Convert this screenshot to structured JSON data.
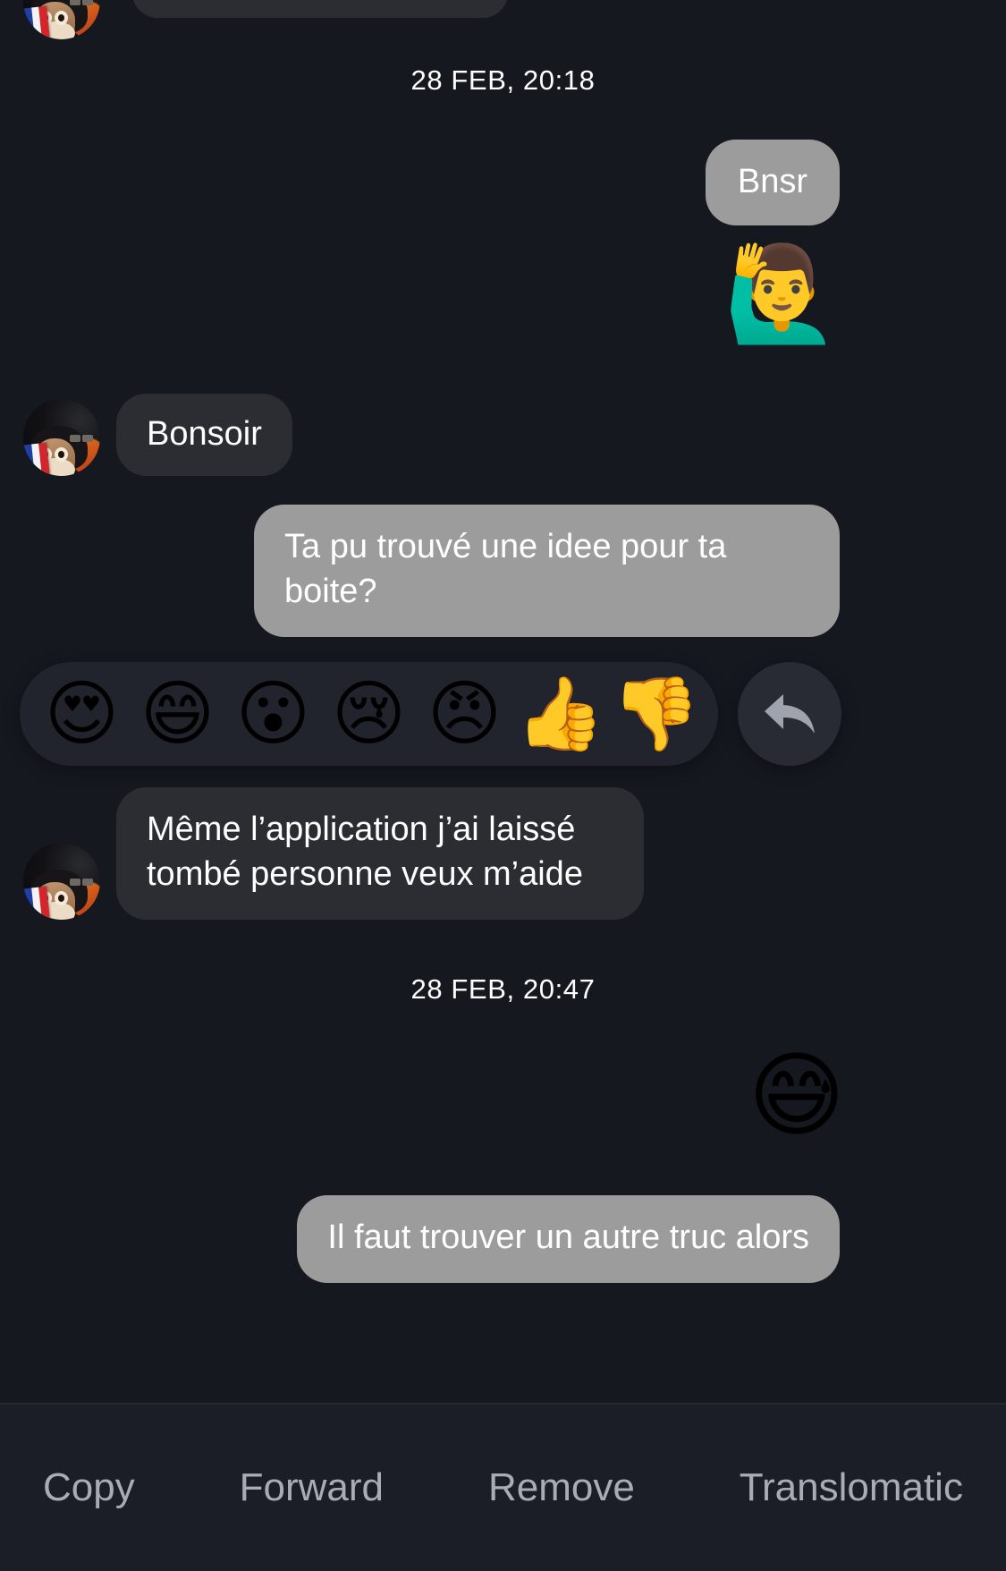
{
  "theme": {
    "background": "#15181f",
    "incoming_bubble": "#2c2d33",
    "selected_bubble": "#9c9c9c",
    "reaction_bar": "#21242c",
    "action_bar": "#1b1e26",
    "action_text": "#a9acb4",
    "text": "#ffffff"
  },
  "conversation": {
    "date_separator_1": "28 FEB, 20:18",
    "date_separator_2": "28 FEB, 20:47",
    "messages": [
      {
        "id": "m0",
        "side": "incoming",
        "type": "text",
        "text": "",
        "partial": true,
        "avatar": "dog-french-flag-avatar"
      },
      {
        "id": "m1",
        "side": "outgoing",
        "type": "text",
        "text": "Bnsr",
        "selected": true
      },
      {
        "id": "m2",
        "side": "outgoing",
        "type": "emoji",
        "emoji": "🙋‍♂️",
        "emoji_name": "man-raising-hand-emoji"
      },
      {
        "id": "m3",
        "side": "incoming",
        "type": "text",
        "text": "Bonsoir",
        "avatar": "dog-french-flag-avatar"
      },
      {
        "id": "m4",
        "side": "outgoing",
        "type": "text",
        "text": "Ta pu trouvé une idee pour ta boite?",
        "selected": true
      },
      {
        "id": "m5",
        "side": "incoming",
        "type": "text",
        "text": "Même l’application j’ai laissé tombé personne veux m’aide",
        "avatar": "dog-french-flag-avatar"
      },
      {
        "id": "m6",
        "side": "outgoing",
        "type": "emoji",
        "emoji": "😅",
        "emoji_name": "grinning-face-with-sweat-emoji"
      },
      {
        "id": "m7",
        "side": "outgoing",
        "type": "text",
        "text": "Il faut trouver un autre truc alors",
        "selected": true
      }
    ]
  },
  "reaction_picker": {
    "reactions": [
      {
        "glyph": "😍",
        "name": "heart-eyes-reaction"
      },
      {
        "glyph": "😄",
        "name": "grinning-smile-reaction"
      },
      {
        "glyph": "😮",
        "name": "open-mouth-reaction"
      },
      {
        "glyph": "😢",
        "name": "crying-face-reaction"
      },
      {
        "glyph": "😠",
        "name": "angry-face-reaction"
      },
      {
        "glyph": "👍",
        "name": "thumbs-up-reaction"
      },
      {
        "glyph": "👎",
        "name": "thumbs-down-reaction"
      }
    ],
    "reply_button": "reply-arrow-icon"
  },
  "action_bar": {
    "buttons": [
      {
        "label": "Copy",
        "name": "copy-button"
      },
      {
        "label": "Forward",
        "name": "forward-button"
      },
      {
        "label": "Remove",
        "name": "remove-button"
      },
      {
        "label": "Translomatic",
        "name": "translomatic-button"
      }
    ]
  }
}
